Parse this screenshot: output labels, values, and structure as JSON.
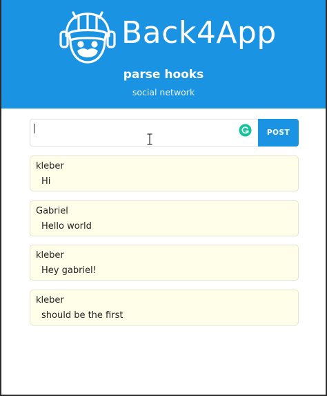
{
  "header": {
    "brand": "Back4App",
    "title": "parse hooks",
    "subtitle": "social network",
    "logo_icon": "back4app-astronaut-logo-icon",
    "background_color": "#1a93e3"
  },
  "composer": {
    "input_value": "",
    "input_placeholder": "",
    "post_label": "POST",
    "assist_icon": "grammarly-icon",
    "assist_color": "#15c39a"
  },
  "posts": [
    {
      "author": "kleber",
      "text": "Hi"
    },
    {
      "author": "Gabriel",
      "text": "Hello world"
    },
    {
      "author": "kleber",
      "text": "Hey gabriel!"
    },
    {
      "author": "kleber",
      "text": "should be the first"
    }
  ],
  "colors": {
    "accent": "#1a93e3",
    "card_background": "#fffee9"
  }
}
